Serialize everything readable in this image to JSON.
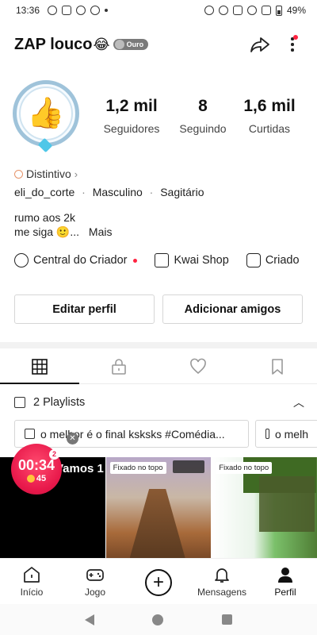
{
  "status_bar": {
    "time": "13:36",
    "battery": "49%"
  },
  "header": {
    "username": "ZAP louco",
    "emoji": "😂",
    "rank_badge": "Ouro"
  },
  "stats": [
    {
      "value": "1,2 mil",
      "label": "Seguidores"
    },
    {
      "value": "8",
      "label": "Seguindo"
    },
    {
      "value": "1,6 mil",
      "label": "Curtidas"
    }
  ],
  "badge": {
    "label": "Distintivo",
    "arrow": "›"
  },
  "info": {
    "handle": "eli_do_corte",
    "sep": "·",
    "gender": "Masculino",
    "sign": "Sagitário"
  },
  "bio": {
    "line1": "rumo aos 2k",
    "line2": "me siga 🙂...",
    "more": "Mais"
  },
  "shortcuts": [
    {
      "label": "Central do Criador",
      "icon": "bolt-icon"
    },
    {
      "label": "Kwai Shop",
      "icon": "shopping-bag-icon"
    },
    {
      "label": "Criado",
      "icon": "store-icon"
    }
  ],
  "buttons": {
    "edit": "Editar perfil",
    "add_friends": "Adicionar amigos"
  },
  "tabs": [
    "grid-icon",
    "lock-icon",
    "heart-icon",
    "bookmark-icon"
  ],
  "playlists": {
    "header": "2 Playlists",
    "items": [
      "o melhor é o final ksksks #Comédia...",
      "o melh"
    ]
  },
  "grid": {
    "cover_title": "Vamos 1",
    "pinned_label": "Fixado no topo"
  },
  "timer": {
    "time": "00:34",
    "coins": "45",
    "count": "2",
    "close": "✕"
  },
  "bottom_nav": {
    "home": "Início",
    "game": "Jogo",
    "create": "+",
    "messages": "Mensagens",
    "profile": "Perfil"
  },
  "colors": {
    "accent_red": "#ff2340",
    "timer_red": "#e8194b",
    "ring_blue": "#9fc3da"
  }
}
